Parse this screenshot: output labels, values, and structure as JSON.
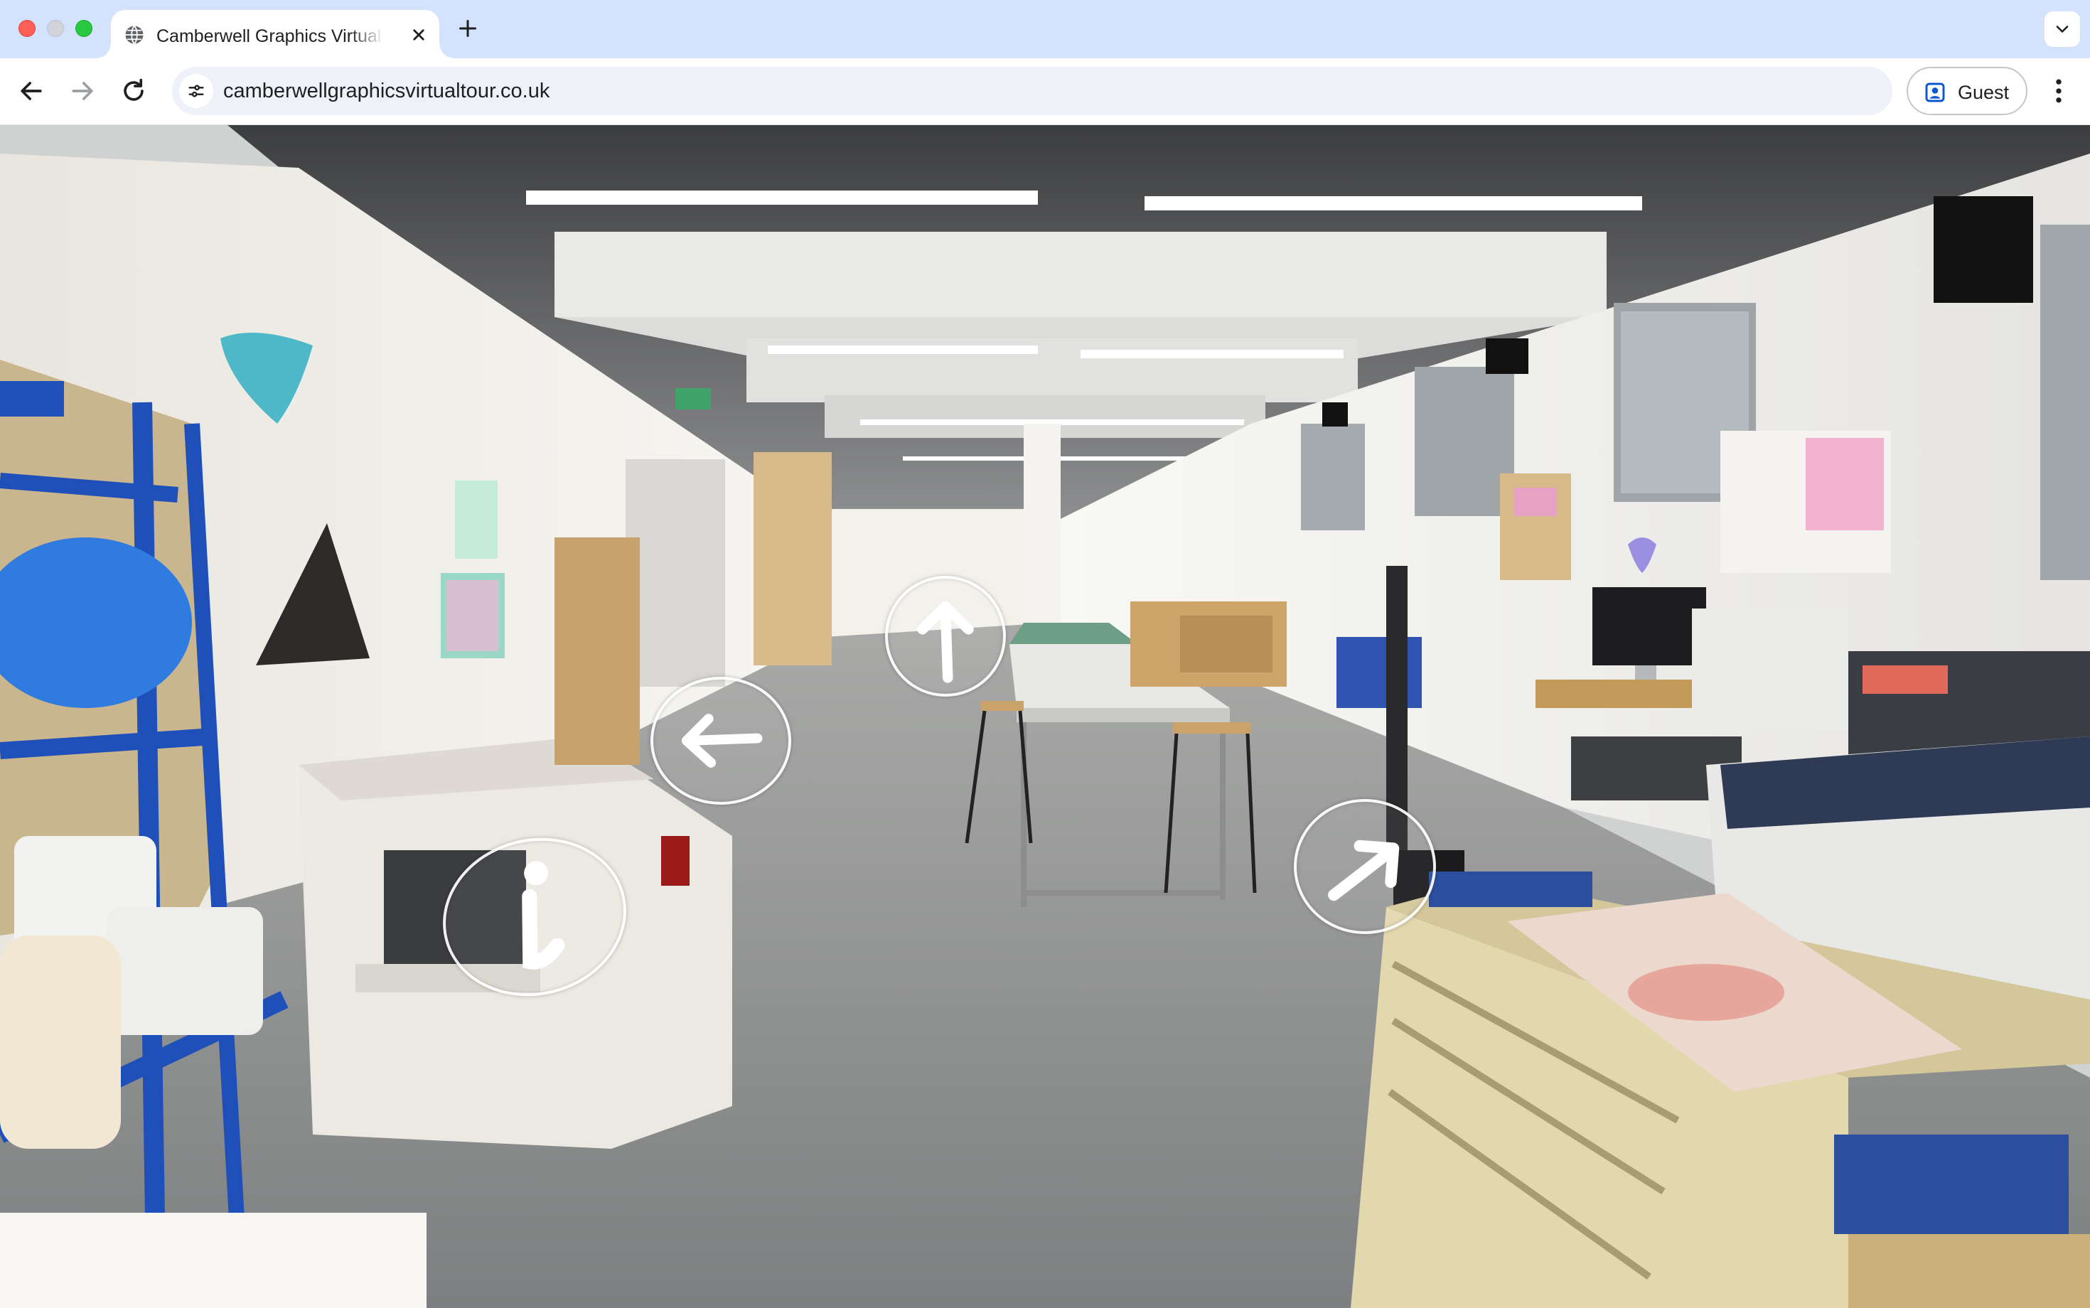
{
  "browser": {
    "tab": {
      "title": "Camberwell Graphics Virtual Tour",
      "favicon": "globe-icon",
      "close_icon": "close-icon"
    },
    "new_tab_icon": "plus-icon",
    "tab_search_icon": "chevron-down-icon",
    "nav": {
      "back_icon": "arrow-left-icon",
      "forward_icon": "arrow-right-icon",
      "reload_icon": "reload-icon"
    },
    "address_bar": {
      "site_info_icon": "tune-icon",
      "url": "camberwellgraphicsvirtualtour.co.uk"
    },
    "profile": {
      "icon": "person-badge-icon",
      "label": "Guest"
    },
    "menu_icon": "more-vert-icon"
  },
  "tour": {
    "scene": "Camberwell Graphics workshop panorama",
    "hotspots": [
      {
        "id": "info",
        "icon": "info-icon"
      },
      {
        "id": "left",
        "icon": "arrow-left-icon"
      },
      {
        "id": "forward",
        "icon": "arrow-up-icon"
      },
      {
        "id": "right",
        "icon": "arrow-up-right-icon"
      }
    ]
  },
  "colors": {
    "tabstrip": "#d3e3fd",
    "omnibox": "#eef1f8",
    "close_dot": "#ff5f57",
    "zoom_dot": "#28c840",
    "shelf_blue": "#1f4fb8"
  }
}
